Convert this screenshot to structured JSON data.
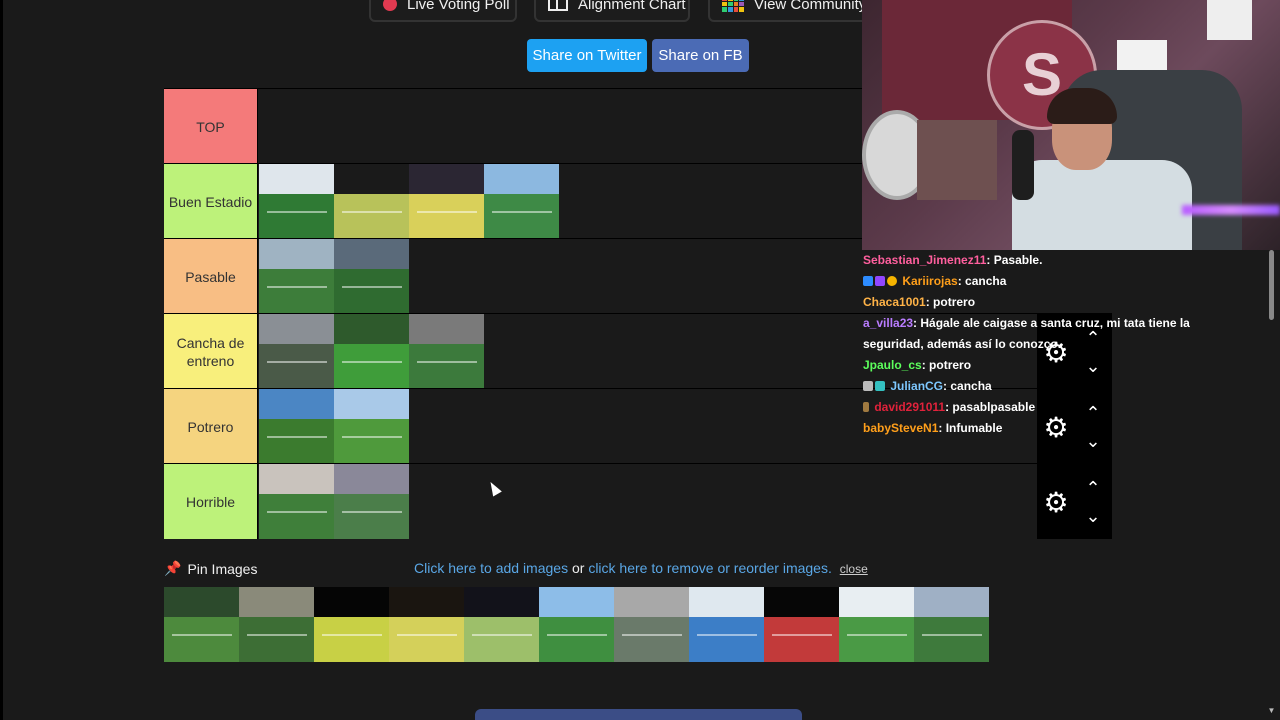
{
  "top_buttons": {
    "poll_label": "Live Voting Poll",
    "alignment_label": "Alignment Chart",
    "community_label": "View Community R"
  },
  "share": {
    "twitter_label": "Share on Twitter",
    "fb_label": "Share on FB"
  },
  "colors": {
    "twitter": "#1da1f2",
    "facebook": "#4b6bb5",
    "tier_top": "#f47a7a",
    "tier_buen": "#bdf27a",
    "tier_pasable": "#f8be84",
    "tier_cancha": "#f8ef7c",
    "tier_potrero": "#f5d47f",
    "tier_horrible": "#bdf27a"
  },
  "tiers": [
    {
      "label": "TOP",
      "image_count": 0
    },
    {
      "label": "Buen Estadio",
      "image_count": 4
    },
    {
      "label": "Pasable",
      "image_count": 2
    },
    {
      "label": "Cancha de entreno",
      "image_count": 3
    },
    {
      "label": "Potrero",
      "image_count": 2
    },
    {
      "label": "Horrible",
      "image_count": 2
    }
  ],
  "pin": {
    "label": "Pin Images",
    "add_link": "Click here to add images",
    "or_text": " or ",
    "remove_link": "click here to remove or reorder images.",
    "close_link": "close"
  },
  "pool_image_count": 11,
  "icons": {
    "gear": "gear-icon",
    "up": "chevron-up-icon",
    "down": "chevron-down-icon",
    "pin": "pin-icon"
  },
  "chat": [
    {
      "user": "Sebastian_Jimenez11",
      "text": ": Pasable.",
      "color": "#ff5f9e"
    },
    {
      "user": "Kariirojas",
      "text": ": cancha",
      "color": "#ff9f1a"
    },
    {
      "user": "Chaca1001",
      "text": ": potrero",
      "color": "#ffb347"
    },
    {
      "user": "a_villa23",
      "text": ": Hágale ale caigase a santa cruz, mi tata tiene la",
      "color": "#b97cff"
    },
    {
      "user": "",
      "text": "seguridad, además así lo conozco.",
      "color": "#ffffff"
    },
    {
      "user": "Jpaulo_cs",
      "text": ": potrero",
      "color": "#5cff5c"
    },
    {
      "user": "JulianCG",
      "text": ": cancha",
      "color": "#7ec8ff"
    },
    {
      "user": "david291011",
      "text": ": pasablpasable",
      "color": "#e0223b"
    },
    {
      "user": "babySteveN1",
      "text": ": Infumable",
      "color": "#ff9f1a"
    }
  ]
}
